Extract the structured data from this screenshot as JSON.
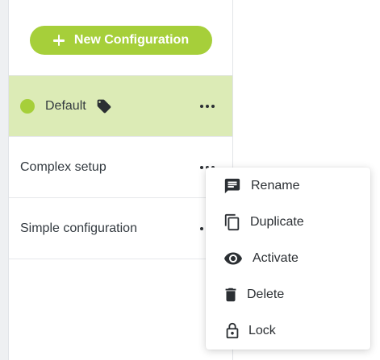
{
  "new_button": {
    "label": "New Configuration",
    "icon": "plus-icon"
  },
  "configurations": [
    {
      "name": "Default",
      "active": true,
      "tagged": true,
      "status_color": "#a6cf3a"
    },
    {
      "name": "Complex setup",
      "active": false,
      "tagged": false
    },
    {
      "name": "Simple configuration",
      "active": false,
      "tagged": false
    }
  ],
  "context_menu": {
    "items": [
      {
        "label": "Rename",
        "icon": "comment-icon"
      },
      {
        "label": "Duplicate",
        "icon": "copy-icon"
      },
      {
        "label": "Activate",
        "icon": "eye-icon"
      },
      {
        "label": "Delete",
        "icon": "trash-icon"
      },
      {
        "label": "Lock",
        "icon": "lock-icon"
      }
    ]
  },
  "colors": {
    "accent": "#a6cf3a",
    "active_row": "#dcebb6",
    "text": "#333a40"
  }
}
